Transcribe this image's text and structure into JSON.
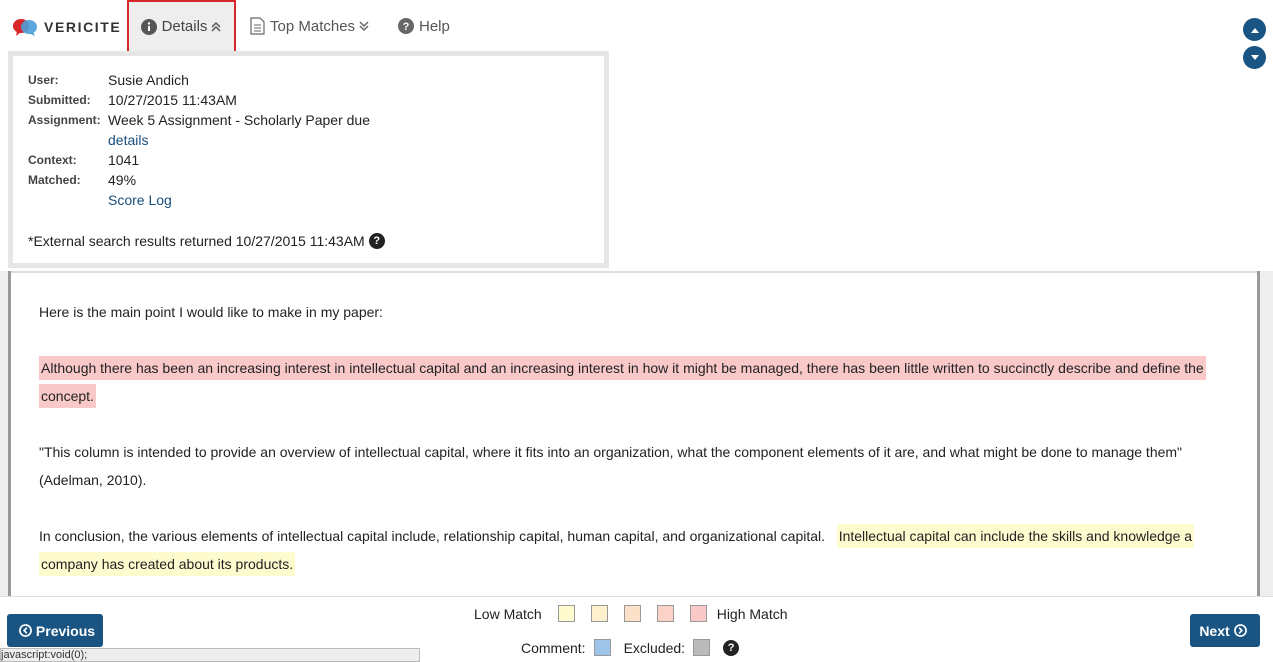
{
  "app": {
    "brand": "VERICITE",
    "brand_colors": {
      "bubble_red": "#d9262a",
      "bubble_blue": "#4a9fd8"
    }
  },
  "toolbar": {
    "details_label": "Details",
    "top_matches_label": "Top Matches",
    "help_label": "Help",
    "icons": [
      "info-icon",
      "document-icon",
      "help-circle-icon",
      "double-chevron-up-icon",
      "double-chevron-down-icon"
    ],
    "active_tab_outline": "#d9262a"
  },
  "details": {
    "user_label": "User:",
    "user_value": "Susie Andich",
    "submitted_label": "Submitted:",
    "submitted_value": "10/27/2015 11:43AM",
    "assignment_label": "Assignment:",
    "assignment_value": "Week 5 Assignment - Scholarly Paper due",
    "assignment_link": "details",
    "context_label": "Context:",
    "context_value": "1041",
    "matched_label": "Matched:",
    "matched_value": "49%",
    "score_log_link": "Score Log",
    "external_note": "*External search results returned 10/27/2015 11:43AM"
  },
  "document": {
    "p1": "Here is the main point I would like to make in my paper:",
    "p2_highlight_high": "Although there has been an increasing interest in intellectual capital and an increasing interest in how it might be managed, there has been little written to succinctly describe and define the concept.",
    "p3": "\"This column is intended to provide an overview of intellectual capital, where it fits into an organization, what the component elements of it are, and what might be done to manage them\" (Adelman, 2010).",
    "p4_plain": "In conclusion, the various elements of intellectual capital include, relationship capital, human capital, and organizational capital.",
    "p4_highlight_low": "Intellectual capital can include the skills and knowledge a company has created about its products."
  },
  "legend": {
    "low_label": "Low Match",
    "high_label": "High Match",
    "comment_label": "Comment:",
    "excluded_label": "Excluded:",
    "colors": {
      "match_1": "#fefccf",
      "match_2": "#fdf0cc",
      "match_3": "#fde0c8",
      "match_4": "#fbd2c8",
      "match_5": "#f9c9c9",
      "comment": "#9ec5e8",
      "excluded": "#bbbbbb"
    }
  },
  "nav": {
    "previous_label": "Previous",
    "next_label": "Next"
  },
  "statusbar": {
    "text": "javascript:void(0);"
  }
}
